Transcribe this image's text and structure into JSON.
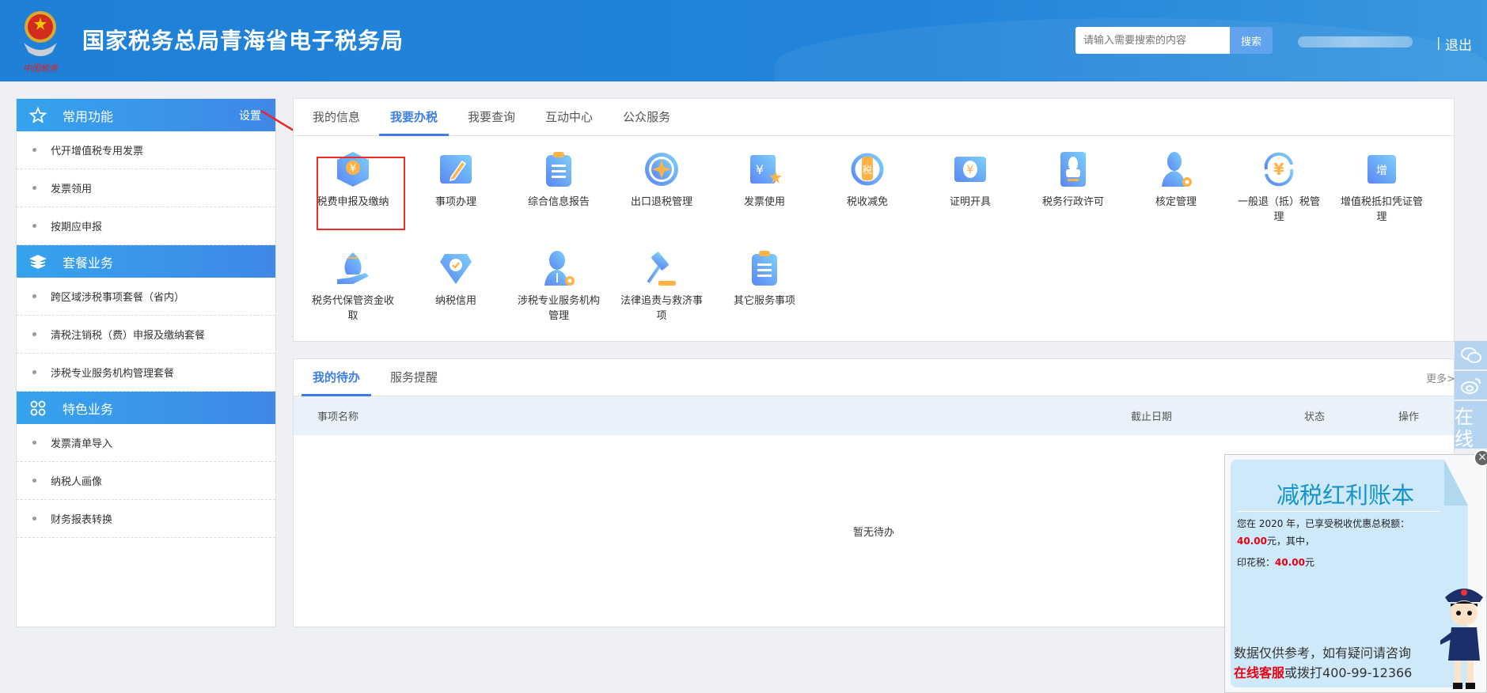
{
  "header": {
    "title": "国家税务总局青海省电子税务局",
    "logo_text": "中国税务",
    "search_placeholder": "请输入需要搜索的内容",
    "search_button": "搜索",
    "separator": "|",
    "logout": "退出"
  },
  "sidebar": {
    "groups": [
      {
        "title": "常用功能",
        "icon": "star-icon",
        "setting": "设置",
        "items": [
          "代开增值税专用发票",
          "发票领用",
          "按期应申报"
        ]
      },
      {
        "title": "套餐业务",
        "icon": "layers-icon",
        "items": [
          "跨区域涉税事项套餐（省内）",
          "清税注销税（费）申报及缴纳套餐",
          "涉税专业服务机构管理套餐"
        ]
      },
      {
        "title": "特色业务",
        "icon": "grid-icon",
        "items": [
          "发票清单导入",
          "纳税人画像",
          "财务报表转换"
        ]
      }
    ]
  },
  "main": {
    "tabs": [
      "我的信息",
      "我要办税",
      "我要查询",
      "互动中心",
      "公众服务"
    ],
    "active_tab": "我要办税",
    "services": [
      {
        "label": "税费申报及缴纳",
        "icon": "tax-box-icon",
        "highlighted": true
      },
      {
        "label": "事项办理",
        "icon": "pencil-ticket-icon"
      },
      {
        "label": "综合信息报告",
        "icon": "clipboard-icon"
      },
      {
        "label": "出口退税管理",
        "icon": "globe-icon"
      },
      {
        "label": "发票使用",
        "icon": "invoice-star-icon"
      },
      {
        "label": "税收减免",
        "icon": "tax-emblem-icon"
      },
      {
        "label": "证明开具",
        "icon": "yuan-ticket-icon"
      },
      {
        "label": "税务行政许可",
        "icon": "stamp-icon"
      },
      {
        "label": "核定管理",
        "icon": "user-gear-icon"
      },
      {
        "label": "一般退（抵）税管理",
        "icon": "yuan-refresh-icon"
      },
      {
        "label": "增值税抵扣凭证管理",
        "icon": "vat-ticket-icon"
      },
      {
        "label": "税务代保管资金收取",
        "icon": "money-bag-hand-icon"
      },
      {
        "label": "纳税信用",
        "icon": "credit-shield-icon"
      },
      {
        "label": "涉税专业服务机构管理",
        "icon": "agent-gear-icon"
      },
      {
        "label": "法律追责与救济事项",
        "icon": "gavel-icon"
      },
      {
        "label": "其它服务事项",
        "icon": "clipboard-icon"
      }
    ]
  },
  "todo": {
    "tabs": [
      "我的待办",
      "服务提醒"
    ],
    "more": "更多>",
    "columns": [
      "事项名称",
      "截止日期",
      "状态",
      "操作"
    ],
    "empty": "暂无待办"
  },
  "floatbar": {
    "items": [
      "wechat-icon",
      "weibo-icon"
    ],
    "online": "在线客服"
  },
  "popup": {
    "title": "减税红利账本",
    "line1": "您在 2020 年，已享受税收优惠总税额：",
    "total": "40.00",
    "line2": "元，其中，",
    "stamp_label": "印花税：",
    "stamp_value": "40.00",
    "yuan": "元",
    "footer1": "数据仅供参考，如有疑问请咨询",
    "footer_link": "在线客服",
    "footer2": "或拨打400-99-12366",
    "close": "×"
  },
  "colors": {
    "header": "#1f80d8",
    "accent": "#3b7ee6",
    "highlight_box": "#ee2b2b",
    "icon_orange": "#ffb347"
  }
}
